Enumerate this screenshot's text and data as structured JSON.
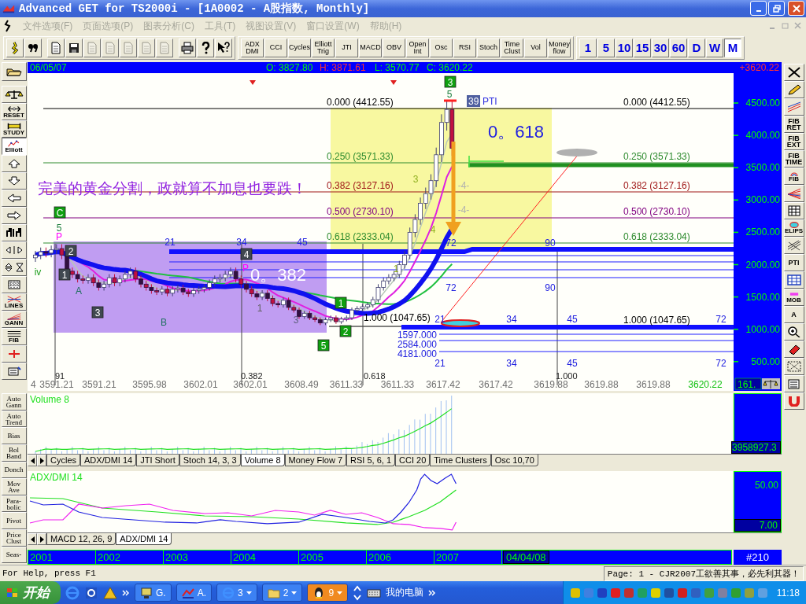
{
  "window": {
    "title": "Advanced GET for TS2000i - [1A0002 - A股指数, Monthly]"
  },
  "menu": [
    {
      "label": "文件选项(F)",
      "disabled": true
    },
    {
      "label": "页面选项(P)",
      "disabled": true
    },
    {
      "label": "图表分析(C)",
      "disabled": true
    },
    {
      "label": "工具(T)",
      "disabled": true
    },
    {
      "label": "视图设置(V)",
      "disabled": true
    },
    {
      "label": "窗口设置(W)",
      "disabled": true
    },
    {
      "label": "帮助(H)",
      "disabled": true
    }
  ],
  "toolbar": {
    "tools": [
      {
        "kind": "figure",
        "disabled": false
      },
      {
        "kind": "quote",
        "disabled": false
      },
      {
        "kind": "new",
        "disabled": false
      },
      {
        "kind": "save",
        "disabled": false
      },
      {
        "kind": "doc",
        "disabled": true
      },
      {
        "kind": "doc",
        "disabled": true
      },
      {
        "kind": "doc",
        "disabled": true
      },
      {
        "kind": "doc",
        "disabled": true
      },
      {
        "kind": "doc",
        "disabled": true
      },
      {
        "kind": "print",
        "disabled": false
      },
      {
        "kind": "help",
        "disabled": false
      },
      {
        "kind": "context-help",
        "disabled": false
      }
    ],
    "studies": [
      "ADX DMI",
      "CCI",
      "Cycles",
      "Elliott Trig",
      "JTI",
      "MACD",
      "OBV",
      "Open Int",
      "Osc",
      "RSI",
      "Stoch",
      "Time Clust",
      "Vol",
      "Money flow"
    ],
    "periods": [
      {
        "label": "1",
        "selected": false
      },
      {
        "label": "5",
        "selected": false
      },
      {
        "label": "10",
        "selected": false
      },
      {
        "label": "15",
        "selected": false
      },
      {
        "label": "30",
        "selected": false
      },
      {
        "label": "60",
        "selected": false
      },
      {
        "label": "D",
        "selected": false
      },
      {
        "label": "W",
        "selected": false
      },
      {
        "label": "M",
        "selected": true
      }
    ]
  },
  "quote": {
    "date": "06/05/07",
    "open": "O: 3827.80",
    "high": "H: 3871.61",
    "low": "L: 3570.77",
    "close": "C: 3620.22",
    "change": "+3620.22"
  },
  "left_tools": [
    {
      "kind": "folder"
    },
    {
      "kind": "balance"
    },
    {
      "kind": "reset",
      "label": "RESET"
    },
    {
      "kind": "study",
      "label": "STUDY"
    },
    {
      "kind": "elliott",
      "label": "Elliott",
      "pressed": true
    },
    {
      "kind": "up"
    },
    {
      "kind": "down"
    },
    {
      "kind": "left"
    },
    {
      "kind": "right"
    },
    {
      "kind": "bars"
    },
    {
      "kind": "mirror"
    },
    {
      "kind": "flip"
    },
    {
      "kind": "grid"
    },
    {
      "kind": "lines",
      "label": "LINES"
    },
    {
      "kind": "gann",
      "label": "GANN"
    },
    {
      "kind": "fib",
      "label": "FIB"
    },
    {
      "kind": "cross"
    },
    {
      "kind": "notepad"
    }
  ],
  "right_tools": [
    {
      "kind": "close"
    },
    {
      "kind": "pencil"
    },
    {
      "kind": "channel"
    },
    {
      "kind": "text",
      "label": "FIB RET"
    },
    {
      "kind": "text",
      "label": "FIB EXT"
    },
    {
      "kind": "text",
      "label": "FIB TIME"
    },
    {
      "kind": "arc",
      "label": "FIB"
    },
    {
      "kind": "fan"
    },
    {
      "kind": "grid"
    },
    {
      "kind": "ellipse",
      "label": "ELIPS"
    },
    {
      "kind": "pattern"
    },
    {
      "kind": "text",
      "label": "PTI"
    },
    {
      "kind": "table"
    },
    {
      "kind": "mob",
      "label": "MOB"
    },
    {
      "kind": "text",
      "label": "A"
    },
    {
      "kind": "zoom"
    },
    {
      "kind": "eraser"
    },
    {
      "kind": "dots"
    },
    {
      "kind": "notepad"
    },
    {
      "kind": "magnet"
    }
  ],
  "chart": {
    "fib_levels": [
      {
        "left": "0.000 (4412.55)",
        "right": "0.000 (4412.55)",
        "color": "#000000"
      },
      {
        "left": "0.250 (3571.33)",
        "right": "0.250 (3571.33)",
        "color": "#2e8b2e"
      },
      {
        "left": "0.382 (3127.16)",
        "right": "0.382 (3127.16)",
        "color": "#a01818"
      },
      {
        "left": "0.500 (2730.10)",
        "right": "0.500 (2730.10)",
        "color": "#800080"
      },
      {
        "left": "0.618 (2333.04)",
        "right": "0.618 (2333.04)",
        "color": "#2e8b2e"
      },
      {
        "left": "1.000 (1047.65)",
        "right": "1.000 (1047.65)",
        "color": "#000000"
      }
    ],
    "annotation": "完美的黄金分割，政就算不加息也要跌！",
    "ratio_large": "0。618",
    "ratio_box": "0。382",
    "pti": {
      "count": "39",
      "label": "PTI"
    },
    "wave_boxes": [
      {
        "text": "C",
        "kind": "green"
      },
      {
        "text": "2",
        "kind": "dark"
      },
      {
        "text": "1",
        "kind": "dark"
      },
      {
        "text": "3",
        "kind": "dark"
      },
      {
        "text": "4",
        "kind": "dark"
      },
      {
        "text": "1",
        "kind": "green"
      },
      {
        "text": "2",
        "kind": "green"
      },
      {
        "text": "5",
        "kind": "green"
      },
      {
        "text": "3",
        "kind": "green"
      }
    ],
    "wave_marks": [
      {
        "text": "5",
        "color": "#208040"
      },
      {
        "text": "P",
        "color": "#ff00ff"
      },
      {
        "text": "iv",
        "color": "#20a020"
      },
      {
        "text": "A",
        "color": "#207060"
      },
      {
        "text": "B",
        "color": "#207060"
      },
      {
        "text": "3",
        "color": "#606080"
      },
      {
        "text": "1",
        "color": "#606060"
      },
      {
        "text": "P",
        "color": "#ff00ff"
      },
      {
        "text": "5",
        "color": "#208040"
      },
      {
        "text": "3",
        "color": "#90b020"
      },
      {
        "text": "4",
        "color": "#90b020"
      },
      {
        "text": "1",
        "color": "#90b020"
      },
      {
        "text": "-4-",
        "color": "#b0b0b0"
      },
      {
        "text": "-4-",
        "color": "#b0b0b0"
      }
    ],
    "time_counts": [
      "21",
      "34",
      "45",
      "72",
      "90",
      "90",
      "72",
      "21",
      "34",
      "45",
      "72",
      "21",
      "34",
      "45",
      "72"
    ],
    "fib_counts": [
      "1597.000",
      "2584.000",
      "4181.000"
    ],
    "x_labels": [
      "4",
      "3591.21",
      "3591.21",
      "3595.98",
      "3602.01",
      "3602.01",
      "3608.49",
      "3611.33",
      "3611.33",
      "3617.42",
      "3617.42",
      "3619.88",
      "3619.88",
      "3619.88",
      "3620.22"
    ],
    "markers": [
      "91",
      "0.382",
      "0.618",
      "1.000"
    ],
    "price_ticks": [
      "4500.00",
      "4000.00",
      "3500.00",
      "3000.00",
      "2500.00",
      "2000.00",
      "1500.00",
      "1000.00",
      "500.00"
    ],
    "last_value": "161."
  },
  "volume": {
    "label": "Volume 8",
    "reading": "3958927.3",
    "tabs": [
      {
        "label": "Cycles",
        "selected": false
      },
      {
        "label": "ADX/DMI 14",
        "selected": false
      },
      {
        "label": "JTI Short",
        "selected": false
      },
      {
        "label": "Stoch 14, 3, 3",
        "selected": false
      },
      {
        "label": "Volume 8",
        "selected": true
      },
      {
        "label": "Money Flow 7",
        "selected": false
      },
      {
        "label": "RSI 5, 6, 1",
        "selected": false
      },
      {
        "label": "CCI 20",
        "selected": false
      },
      {
        "label": "Time Clusters",
        "selected": false
      },
      {
        "label": "Osc 10,70",
        "selected": false
      }
    ]
  },
  "adx": {
    "label": "ADX/DMI 14",
    "ticks": [
      "50.00",
      "7.00"
    ],
    "tabs": [
      {
        "label": "MACD 12, 26, 9",
        "selected": false
      },
      {
        "label": "ADX/DMI 14",
        "selected": true
      }
    ]
  },
  "lower_tools": [
    "Auto Gann",
    "Auto Trend",
    "Bias",
    "Bol Band",
    "Donch",
    "Mov Ave",
    "Para-bolic",
    "Pivot",
    "Price Clust",
    "Seas-"
  ],
  "timeline": {
    "years": [
      "2001",
      "2002",
      "2003",
      "2004",
      "2005",
      "2006",
      "2007"
    ],
    "date": "04/04/08",
    "bar_count": "#210"
  },
  "status": {
    "help": "For Help, press F1",
    "page": "Page: 1 - CJR2007工欲善其事，必先利其器！"
  },
  "taskbar": {
    "start": "开始",
    "tasks": [
      {
        "label": "G.",
        "kind": "app",
        "selected": false
      },
      {
        "label": "A.",
        "kind": "chart",
        "selected": false
      },
      {
        "label": "3",
        "kind": "browser",
        "selected": false
      },
      {
        "label": "2",
        "kind": "folder",
        "selected": false
      },
      {
        "label": "9",
        "kind": "chat",
        "selected": true
      }
    ],
    "desktop": "我的电脑",
    "clock": "11:18"
  }
}
